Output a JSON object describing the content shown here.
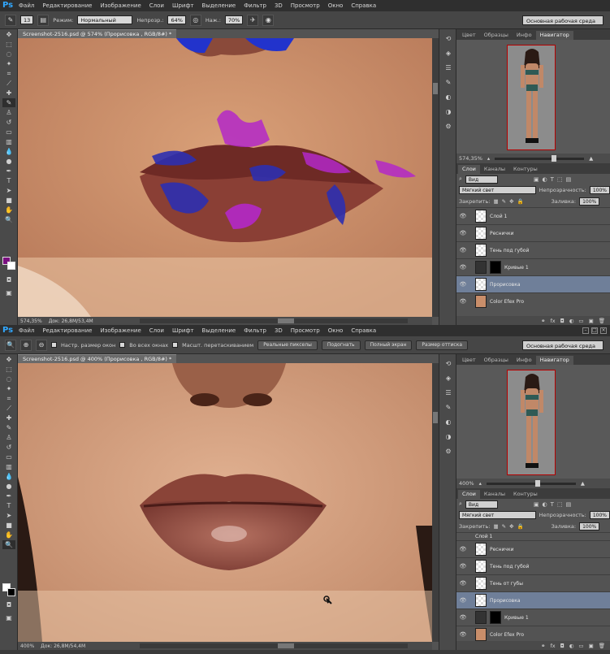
{
  "menu": [
    "Файл",
    "Редактирование",
    "Изображение",
    "Слои",
    "Шрифт",
    "Выделение",
    "Фильтр",
    "3D",
    "Просмотр",
    "Окно",
    "Справка"
  ],
  "logo": "Ps",
  "workspace": "Основная рабочая среда",
  "top": {
    "options": {
      "brush_size": "13",
      "mode_label": "Режим:",
      "mode_value": "Нормальный",
      "opacity_label": "Непрозр.:",
      "opacity_value": "64%",
      "flow_label": "Наж.:",
      "flow_value": "70%"
    },
    "doc_tab": "Screenshot-2516.psd @ 574% (Прорисовка , RGB/8#) *",
    "status_zoom": "574,35%",
    "status_doc": "Док: 26,8M/53,4M",
    "nav_zoom": "574,35%",
    "layers_filter": "Вид",
    "blend_mode": "Мягкий свет",
    "opacity_label": "Непрозрачность:",
    "opacity_value": "100%",
    "lock_label": "Закрепить:",
    "fill_label": "Заливка:",
    "fill_value": "100%",
    "layers": [
      {
        "name": "Слой 1",
        "thumb": "transparent",
        "selected": false
      },
      {
        "name": "Реснички",
        "thumb": "transparent",
        "selected": false
      },
      {
        "name": "Тень под губой",
        "thumb": "transparent",
        "selected": false
      },
      {
        "name": "Кривые 1",
        "thumb": "adjustment",
        "selected": false
      },
      {
        "name": "Прорисовка",
        "thumb": "transparent",
        "selected": true
      },
      {
        "name": "Color Efex Pro",
        "thumb": "photo",
        "selected": false
      }
    ]
  },
  "bottom": {
    "options": {
      "resize_windows": "Настр. размер окон",
      "all_windows": "Во всех окнах",
      "scrubby_zoom": "Масшт. перетаскиванием",
      "actual_pixels": "Реальные пикселы",
      "fit_screen": "Подогнать",
      "fill_screen": "Полный экран",
      "print_size": "Размер оттиска"
    },
    "doc_tab": "Screenshot-2516.psd @ 400% (Прорисовка , RGB/8#) *",
    "status_zoom": "400%",
    "status_doc": "Док: 26,8M/54,4M",
    "nav_zoom": "400%",
    "layers_filter": "Вид",
    "blend_mode": "Мягкий свет",
    "opacity_label": "Непрозрачность:",
    "opacity_value": "100%",
    "lock_label": "Закрепить:",
    "fill_label": "Заливка:",
    "fill_value": "100%",
    "layers": [
      {
        "name": "Слой 1",
        "thumb": "transparent",
        "selected": false
      },
      {
        "name": "Реснички",
        "thumb": "transparent",
        "selected": false
      },
      {
        "name": "Тень под губой",
        "thumb": "transparent",
        "selected": false
      },
      {
        "name": "Тень от губы",
        "thumb": "transparent",
        "selected": false
      },
      {
        "name": "Прорисовка",
        "thumb": "transparent",
        "selected": true
      },
      {
        "name": "Кривые 1",
        "thumb": "adjustment",
        "selected": false
      },
      {
        "name": "Color Efex Pro",
        "thumb": "photo",
        "selected": false
      }
    ]
  },
  "panel_tabs_top": [
    "Цвет",
    "Образцы",
    "Инфо",
    "Навигатор"
  ],
  "panel_tabs_layers": [
    "Слои",
    "Каналы",
    "Контуры"
  ],
  "colors": {
    "foreground": "#7a0f80",
    "background": "#ffffff",
    "selection": "#6f7f99"
  }
}
